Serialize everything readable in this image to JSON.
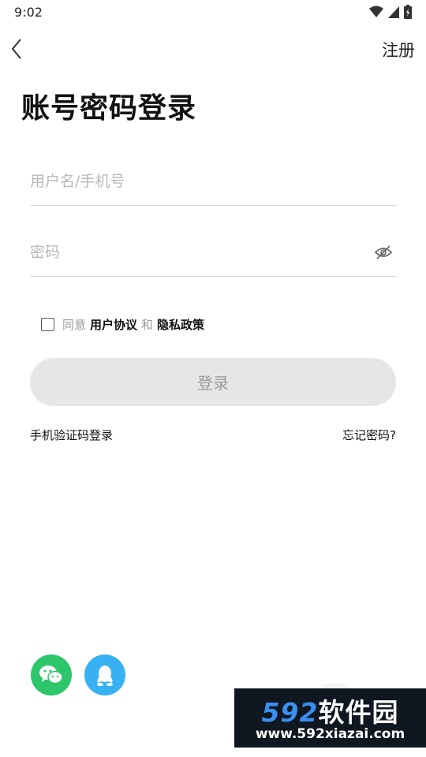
{
  "status_bar": {
    "time": "9:02"
  },
  "topbar": {
    "register_label": "注册"
  },
  "page_title": "账号密码登录",
  "form": {
    "username_placeholder": "用户名/手机号",
    "password_placeholder": "密码"
  },
  "agreement": {
    "prefix": "同意",
    "user_agreement": "用户协议",
    "conjunction": "和",
    "privacy_policy": "隐私政策"
  },
  "login_button_label": "登录",
  "links": {
    "sms_login": "手机验证码登录",
    "forgot_password": "忘记密码?"
  },
  "social": {
    "wechat_icon": "wechat-icon",
    "qq_icon": "qq-icon"
  },
  "watermark": {
    "brand_number": "592",
    "brand_name": "软件园",
    "url": "www.592xiazai.com"
  },
  "colors": {
    "wechat": "#2dc66b",
    "qq": "#38b1f3",
    "button_bg": "#e6e6e6"
  }
}
